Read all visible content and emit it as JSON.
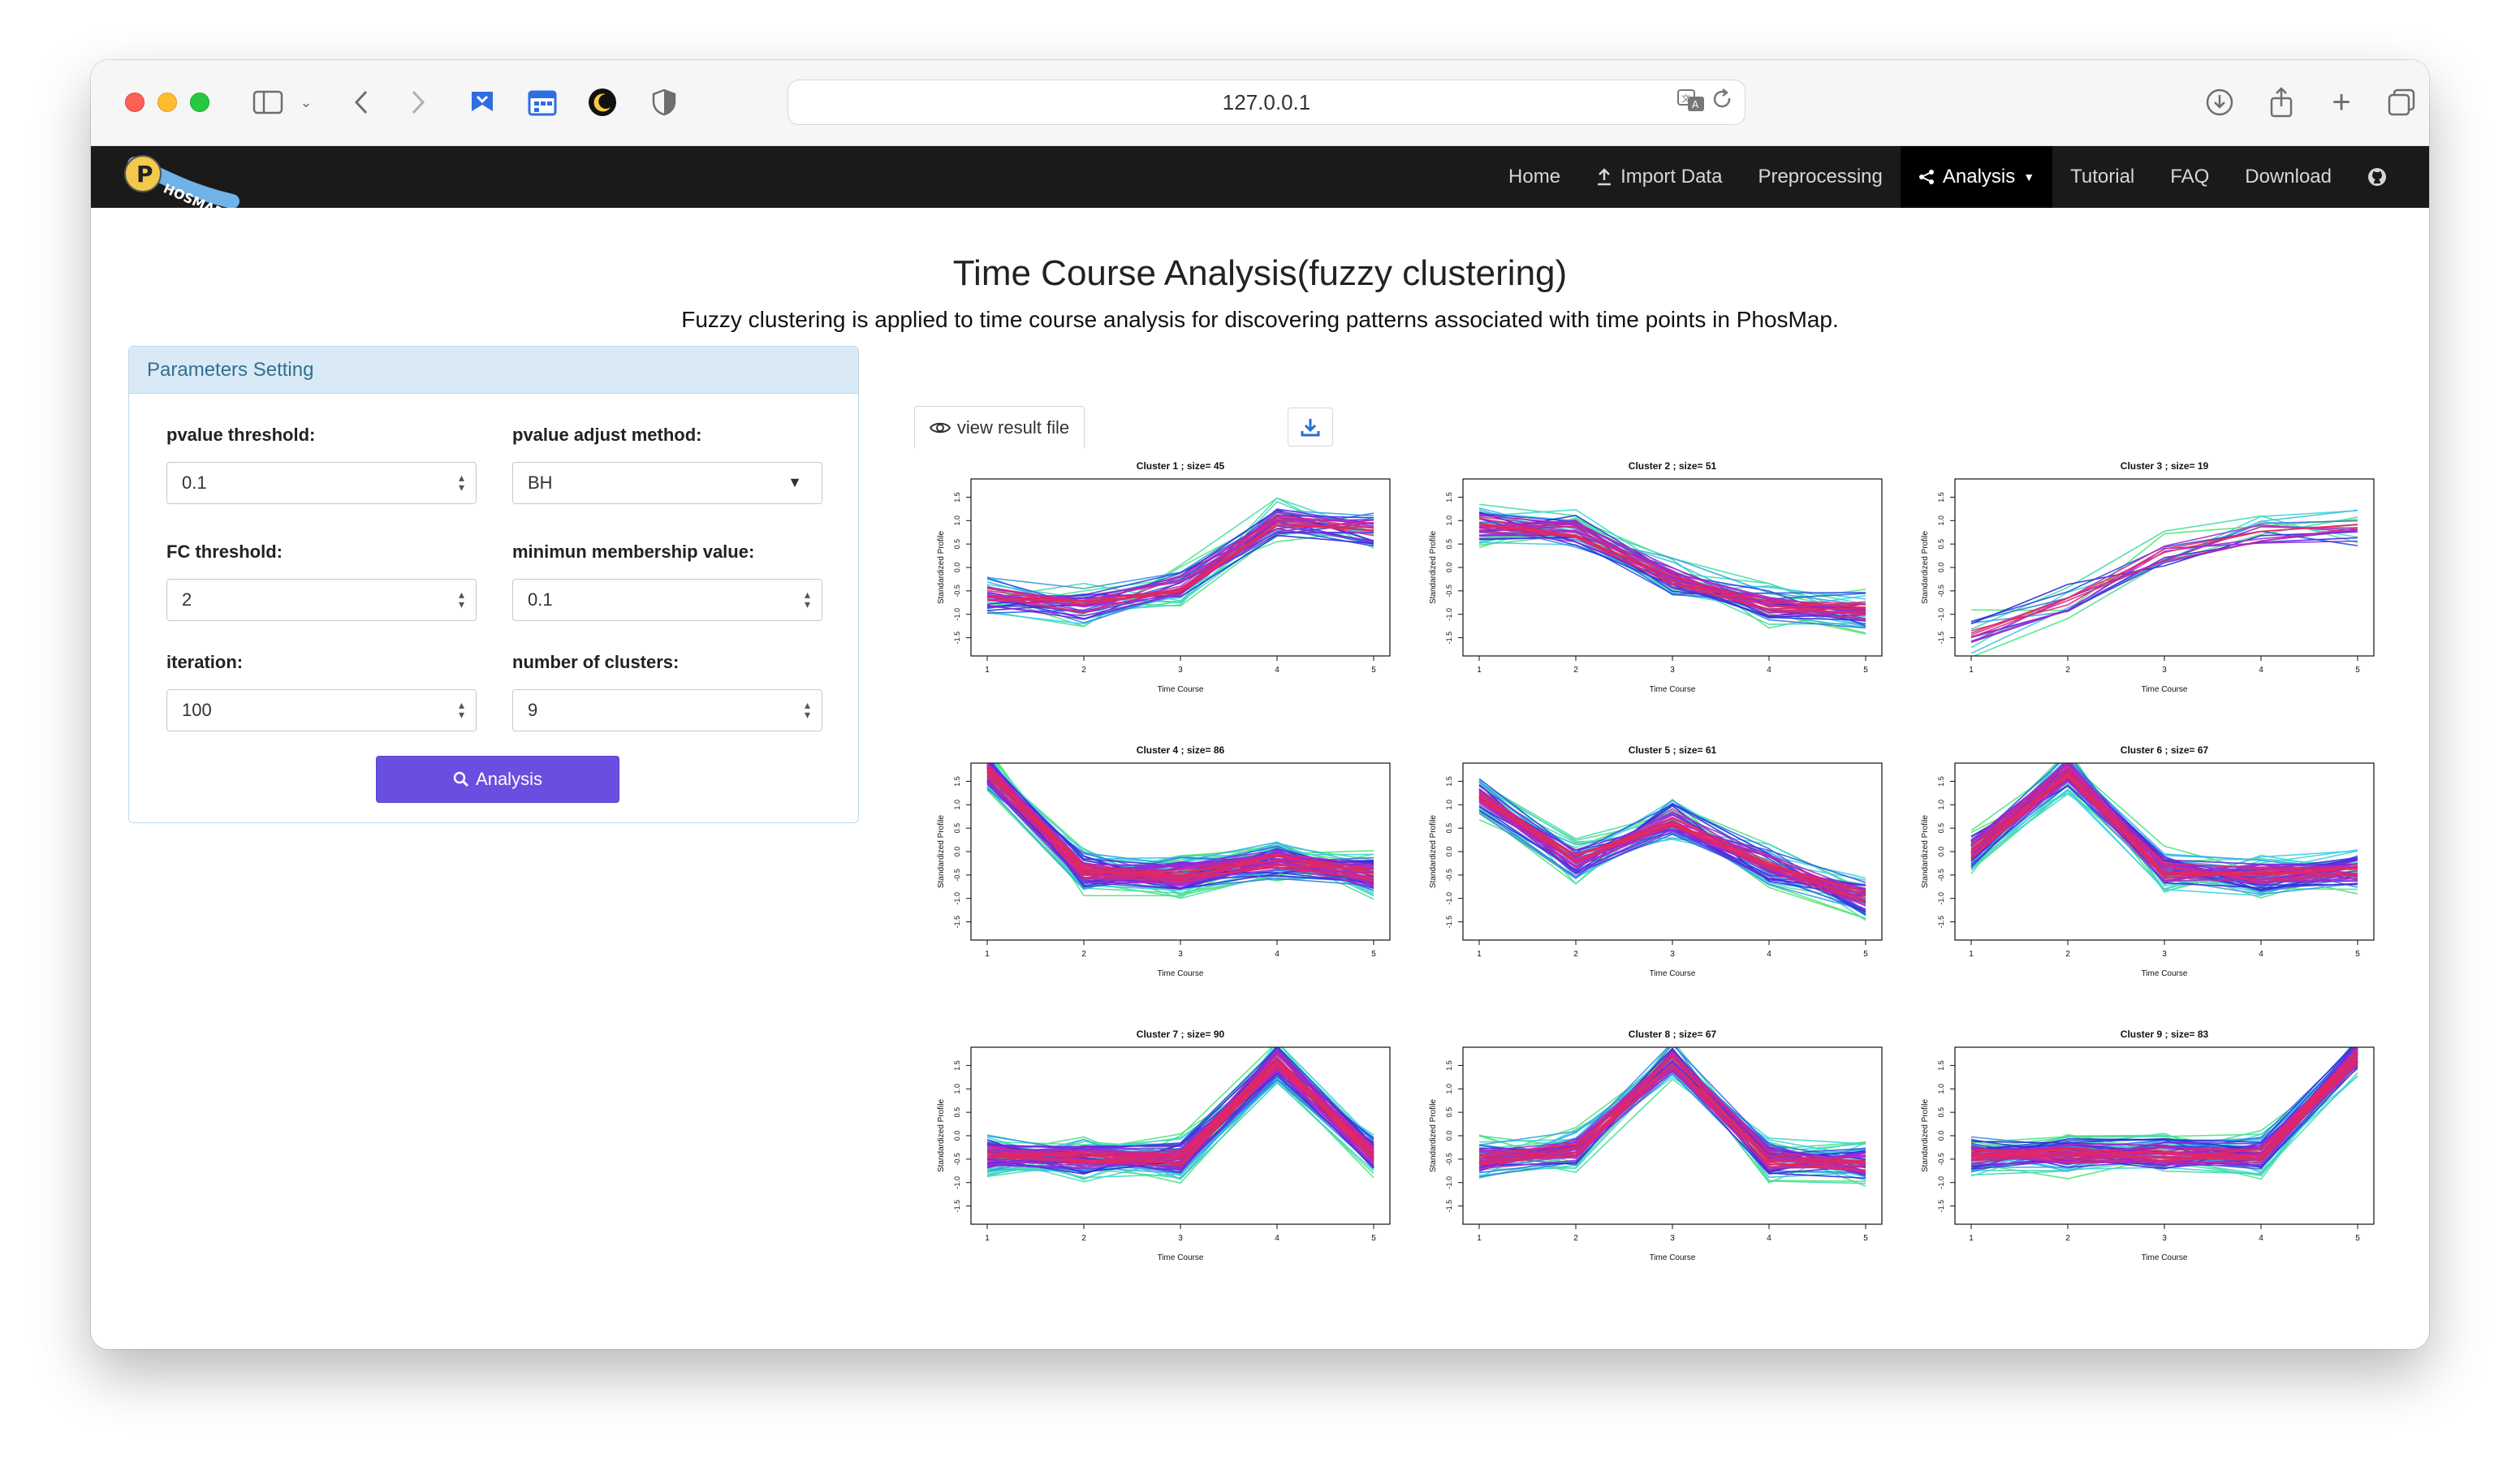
{
  "browser": {
    "url": "127.0.0.1"
  },
  "app": {
    "logo_letter": "P",
    "logo_text": "HOSMAP",
    "nav": [
      {
        "label": "Home"
      },
      {
        "label": "Import Data",
        "icon": "upload-icon"
      },
      {
        "label": "Preprocessing"
      },
      {
        "label": "Analysis",
        "icon": "share-icon",
        "active": true
      },
      {
        "label": "Tutorial"
      },
      {
        "label": "FAQ"
      },
      {
        "label": "Download"
      }
    ]
  },
  "page": {
    "title": "Time Course Analysis(fuzzy clustering)",
    "subtitle": "Fuzzy clustering is applied to time course analysis for discovering patterns associated with time points in PhosMap."
  },
  "parameters": {
    "title": "Parameters Setting",
    "pvalue_threshold": {
      "label": "pvalue threshold:",
      "value": "0.1"
    },
    "pvalue_adjust": {
      "label": "pvalue adjust method:",
      "value": "BH"
    },
    "fc_threshold": {
      "label": "FC threshold:",
      "value": "2"
    },
    "min_membership": {
      "label": "minimun membership value:",
      "value": "0.1"
    },
    "iteration": {
      "label": "iteration:",
      "value": "100"
    },
    "num_clusters": {
      "label": "number of clusters:",
      "value": "9"
    },
    "analysis_button": "Analysis"
  },
  "results": {
    "tab_label": "view result file"
  },
  "colors": {
    "accent": "#6a4ee0",
    "panel_head": "#d9eaf6",
    "navbar": "#1a1a1a"
  },
  "chart_data": [
    {
      "type": "line",
      "title": "Cluster 1 ; size= 45",
      "xlabel": "Time Course",
      "ylabel": "Standardized Profile",
      "x": [
        1,
        2,
        3,
        4,
        5
      ],
      "ylim": [
        -1.5,
        1.5
      ],
      "size": 45,
      "centroid": [
        -0.6,
        -0.8,
        -0.4,
        1.0,
        0.8
      ]
    },
    {
      "type": "line",
      "title": "Cluster 2 ; size= 51",
      "xlabel": "Time Course",
      "ylabel": "Standardized Profile",
      "x": [
        1,
        2,
        3,
        4,
        5
      ],
      "ylim": [
        -1.5,
        1.5
      ],
      "size": 51,
      "centroid": [
        0.9,
        0.8,
        -0.2,
        -0.8,
        -0.9
      ]
    },
    {
      "type": "line",
      "title": "Cluster 3 ; size= 19",
      "xlabel": "Time Course",
      "ylabel": "Standardized Profile",
      "x": [
        1,
        2,
        3,
        4,
        5
      ],
      "ylim": [
        -1.5,
        1.5
      ],
      "size": 19,
      "centroid": [
        -1.4,
        -0.7,
        0.3,
        0.7,
        0.8
      ]
    },
    {
      "type": "line",
      "title": "Cluster 4 ; size= 86",
      "xlabel": "Time Course",
      "ylabel": "Standardized Profile",
      "x": [
        1,
        2,
        3,
        4,
        5
      ],
      "ylim": [
        -1.5,
        1.5
      ],
      "size": 86,
      "centroid": [
        1.7,
        -0.4,
        -0.5,
        -0.2,
        -0.5
      ]
    },
    {
      "type": "line",
      "title": "Cluster 5 ; size= 61",
      "xlabel": "Time Course",
      "ylabel": "Standardized Profile",
      "x": [
        1,
        2,
        3,
        4,
        5
      ],
      "ylim": [
        -1.5,
        1.5
      ],
      "size": 61,
      "centroid": [
        1.2,
        -0.2,
        0.7,
        -0.3,
        -1.0
      ]
    },
    {
      "type": "line",
      "title": "Cluster 6 ; size= 67",
      "xlabel": "Time Course",
      "ylabel": "Standardized Profile",
      "x": [
        1,
        2,
        3,
        4,
        5
      ],
      "ylim": [
        -1.5,
        1.5
      ],
      "size": 67,
      "centroid": [
        0.0,
        1.7,
        -0.4,
        -0.5,
        -0.4
      ]
    },
    {
      "type": "line",
      "title": "Cluster 7 ; size= 90",
      "xlabel": "Time Course",
      "ylabel": "Standardized Profile",
      "x": [
        1,
        2,
        3,
        4,
        5
      ],
      "ylim": [
        -1.5,
        1.5
      ],
      "size": 90,
      "centroid": [
        -0.4,
        -0.5,
        -0.5,
        1.6,
        -0.4
      ]
    },
    {
      "type": "line",
      "title": "Cluster 8 ; size= 67",
      "xlabel": "Time Course",
      "ylabel": "Standardized Profile",
      "x": [
        1,
        2,
        3,
        4,
        5
      ],
      "ylim": [
        -1.5,
        1.5
      ],
      "size": 67,
      "centroid": [
        -0.5,
        -0.3,
        1.6,
        -0.5,
        -0.6
      ]
    },
    {
      "type": "line",
      "title": "Cluster 9 ; size= 83",
      "xlabel": "Time Course",
      "ylabel": "Standardized Profile",
      "x": [
        1,
        2,
        3,
        4,
        5
      ],
      "ylim": [
        -1.5,
        1.5
      ],
      "size": 83,
      "centroid": [
        -0.4,
        -0.4,
        -0.4,
        -0.4,
        1.7
      ]
    }
  ]
}
